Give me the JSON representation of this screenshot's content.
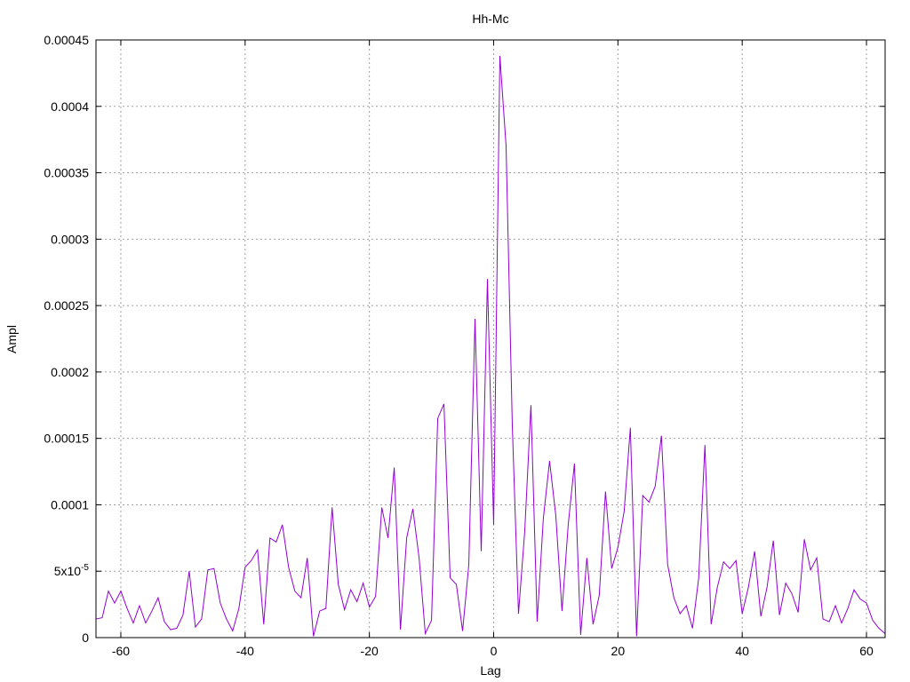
{
  "chart_data": {
    "type": "line",
    "title": "Hh-Mc",
    "xlabel": "Lag",
    "ylabel": "Ampl",
    "xlim": [
      -64,
      63
    ],
    "ylim": [
      0,
      0.00045
    ],
    "grid": true,
    "x_ticks": [
      -60,
      -40,
      -20,
      0,
      20,
      40,
      60
    ],
    "x_tick_labels": [
      "-60",
      "-40",
      "-20",
      "0",
      "20",
      "40",
      "60"
    ],
    "y_ticks": [
      0,
      5e-05,
      0.0001,
      0.00015,
      0.0002,
      0.00025,
      0.0003,
      0.00035,
      0.0004,
      0.00045
    ],
    "y_tick_labels": [
      "0",
      "5x10-5",
      "0.0001",
      "0.00015",
      "0.0002",
      "0.00025",
      "0.0003",
      "0.00035",
      "0.0004",
      "0.00045"
    ],
    "series_color": "#9400d3",
    "series": [
      {
        "x": [
          -64,
          -63,
          -62,
          -61,
          -60,
          -59,
          -58,
          -57,
          -56,
          -55,
          -54,
          -53,
          -52,
          -51,
          -50,
          -49,
          -48,
          -47,
          -46,
          -45,
          -44,
          -43,
          -42,
          -41,
          -40,
          -39,
          -38,
          -37,
          -36,
          -35,
          -34,
          -33,
          -32,
          -31,
          -30,
          -29,
          -28,
          -27,
          -26,
          -25,
          -24,
          -23,
          -22,
          -21,
          -20,
          -19,
          -18,
          -17,
          -16,
          -15,
          -14,
          -13,
          -12,
          -11,
          -10,
          -9,
          -8,
          -7,
          -6,
          -5,
          -4,
          -3,
          -2,
          -1,
          0,
          1,
          2,
          3,
          4,
          5,
          6,
          7,
          8,
          9,
          10,
          11,
          12,
          13,
          14,
          15,
          16,
          17,
          18,
          19,
          20,
          21,
          22,
          23,
          24,
          25,
          26,
          27,
          28,
          29,
          30,
          31,
          32,
          33,
          34,
          35,
          36,
          37,
          38,
          39,
          40,
          41,
          42,
          43,
          44,
          45,
          46,
          47,
          48,
          49,
          50,
          51,
          52,
          53,
          54,
          55,
          56,
          57,
          58,
          59,
          60,
          61,
          62,
          63
        ],
        "values": [
          1.4e-05,
          1.5e-05,
          3.5e-05,
          2.6e-05,
          3.5e-05,
          2.2e-05,
          1.1e-05,
          2.4e-05,
          1.1e-05,
          2e-05,
          3e-05,
          1.2e-05,
          6e-06,
          7e-06,
          1.7e-05,
          5e-05,
          8e-06,
          1.4e-05,
          5.1e-05,
          5.2e-05,
          2.6e-05,
          1.4e-05,
          5e-06,
          2.2e-05,
          5.3e-05,
          5.8e-05,
          6.6e-05,
          1e-05,
          7.5e-05,
          7.2e-05,
          8.5e-05,
          5.3e-05,
          3.5e-05,
          3e-05,
          6e-05,
          1e-06,
          2e-05,
          2.2e-05,
          9.8e-05,
          4e-05,
          2.1e-05,
          3.6e-05,
          2.7e-05,
          4.1e-05,
          2.3e-05,
          3.1e-05,
          9.8e-05,
          7.5e-05,
          0.000128,
          6e-06,
          7.5e-05,
          9.7e-05,
          6e-05,
          3e-06,
          1.3e-05,
          0.000165,
          0.000176,
          4.5e-05,
          4e-05,
          5e-06,
          5.5e-05,
          0.00024,
          6.5e-05,
          0.00027,
          8.5e-05,
          0.000438,
          0.00037,
          0.00016,
          1.8e-05,
          8e-05,
          0.000175,
          1.2e-05,
          9e-05,
          0.000133,
          9.2e-05,
          2e-05,
          8.5e-05,
          0.000131,
          2e-06,
          6e-05,
          1e-05,
          3.2e-05,
          0.00011,
          5.2e-05,
          6.8e-05,
          9.5e-05,
          0.000158,
          1e-06,
          0.000107,
          0.000102,
          0.000114,
          0.000152,
          5.5e-05,
          3e-05,
          1.8e-05,
          2.4e-05,
          7e-06,
          4.5e-05,
          0.000145,
          1e-05,
          3.8e-05,
          5.7e-05,
          5.2e-05,
          5.8e-05,
          1.8e-05,
          3.8e-05,
          6.5e-05,
          1.6e-05,
          3.8e-05,
          7.3e-05,
          1.7e-05,
          4.1e-05,
          3.3e-05,
          1.9e-05,
          7.4e-05,
          5.1e-05,
          6e-05,
          1.4e-05,
          1.2e-05,
          2.4e-05,
          1.1e-05,
          2.2e-05,
          3.6e-05,
          2.9e-05,
          2.6e-05,
          1.3e-05,
          7e-06,
          3e-06
        ]
      }
    ]
  }
}
